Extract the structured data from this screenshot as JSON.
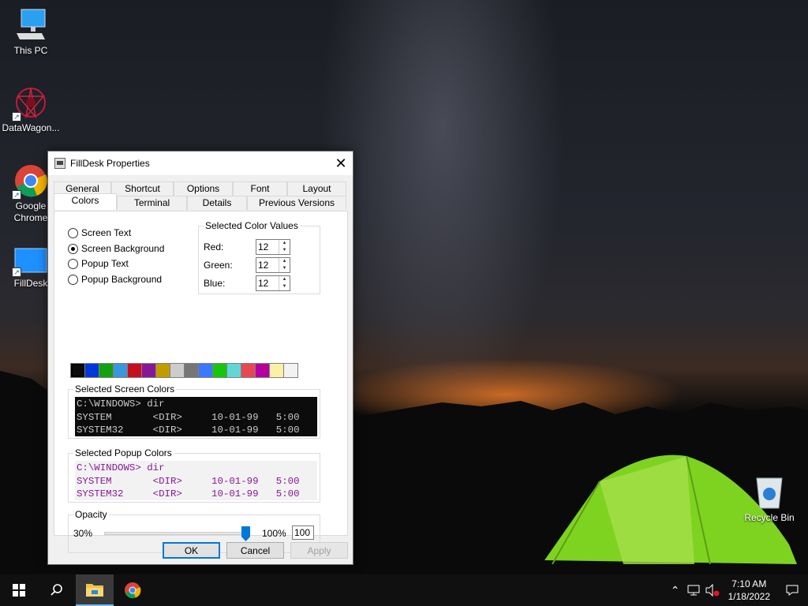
{
  "desktop": {
    "icons": [
      {
        "label": "This PC"
      },
      {
        "label": "DataWagon..."
      },
      {
        "label": "Google Chrome"
      },
      {
        "label": "FillDesk"
      },
      {
        "label": "Recycle Bin"
      }
    ]
  },
  "window": {
    "title": "FillDesk Properties",
    "tabs_row1": [
      "General",
      "Shortcut",
      "Options",
      "Font",
      "Layout"
    ],
    "tabs_row2": [
      "Colors",
      "Terminal",
      "Details",
      "Previous Versions"
    ],
    "active_tab": "Colors",
    "radio_options": [
      {
        "label": "Screen Text",
        "checked": false
      },
      {
        "label": "Screen Background",
        "checked": true
      },
      {
        "label": "Popup Text",
        "checked": false
      },
      {
        "label": "Popup Background",
        "checked": false
      }
    ],
    "color_values": {
      "legend": "Selected Color Values",
      "red_label": "Red:",
      "red": "12",
      "green_label": "Green:",
      "green": "12",
      "blue_label": "Blue:",
      "blue": "12"
    },
    "palette": [
      "#0c0c0c",
      "#0037da",
      "#13a10e",
      "#3a96dd",
      "#c50f1f",
      "#881798",
      "#c19c00",
      "#cccccc",
      "#767676",
      "#3b78ff",
      "#16c60c",
      "#61d6d6",
      "#e74856",
      "#b4009e",
      "#f9f1a5",
      "#f2f2f2"
    ],
    "selected_palette_index": 0,
    "screen_colors": {
      "legend": "Selected Screen Colors",
      "lines": [
        "C:\\WINDOWS> dir",
        "SYSTEM       <DIR>     10-01-99   5:00",
        "SYSTEM32     <DIR>     10-01-99   5:00"
      ]
    },
    "popup_colors": {
      "legend": "Selected Popup Colors",
      "lines": [
        "C:\\WINDOWS> dir",
        "SYSTEM       <DIR>     10-01-99   5:00",
        "SYSTEM32     <DIR>     10-01-99   5:00"
      ]
    },
    "opacity": {
      "legend": "Opacity",
      "min_label": "30%",
      "max_label": "100%",
      "value": "100"
    },
    "buttons": {
      "ok": "OK",
      "cancel": "Cancel",
      "apply": "Apply"
    }
  },
  "taskbar": {
    "time": "7:10 AM",
    "date": "1/18/2022"
  }
}
